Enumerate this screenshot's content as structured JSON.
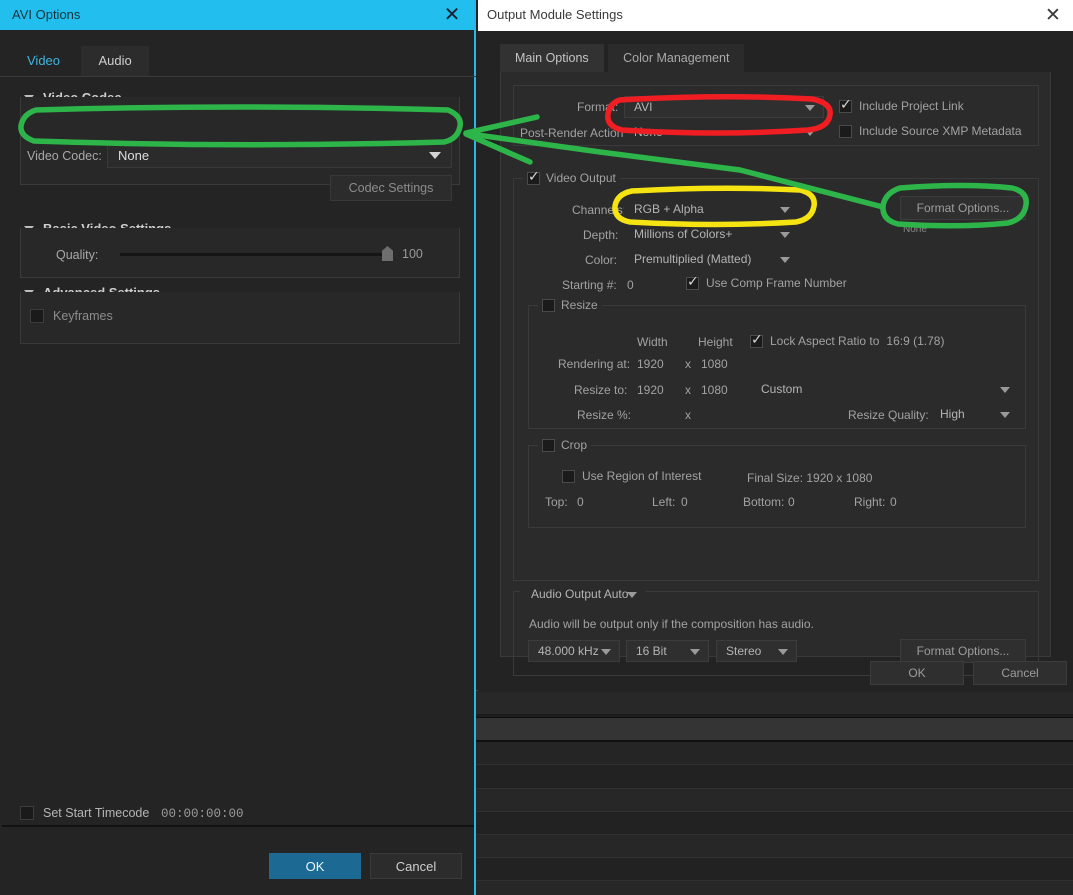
{
  "avi_dialog": {
    "title": "AVI Options",
    "close_icon": "close-icon",
    "tabs": [
      {
        "label": "Video",
        "active": true
      },
      {
        "label": "Audio",
        "active": false
      }
    ],
    "sections": {
      "video_codec": {
        "title": "Video Codec",
        "codec_label": "Video Codec:",
        "codec_value": "None",
        "codec_settings_button": "Codec Settings"
      },
      "basic_video_settings": {
        "title": "Basic Video Settings",
        "quality_label": "Quality:",
        "quality_value": "100"
      },
      "advanced_settings": {
        "title": "Advanced Settings",
        "keyframes_label": "Keyframes",
        "keyframes_checked": false
      }
    },
    "footer": {
      "set_start_timecode_label": "Set Start Timecode",
      "set_start_timecode_checked": false,
      "timecode_value": "00:00:00:00",
      "ok_label": "OK",
      "cancel_label": "Cancel"
    }
  },
  "output_module_dialog": {
    "title": "Output Module Settings",
    "close_icon": "close-icon",
    "tabs": [
      {
        "label": "Main Options",
        "active": true
      },
      {
        "label": "Color Management",
        "active": false
      }
    ],
    "format_group": {
      "format_label": "Format:",
      "format_value": "AVI",
      "post_render_label": "Post-Render Action:",
      "post_render_value": "None",
      "include_project_link_label": "Include Project Link",
      "include_project_link_checked": true,
      "include_xmp_label": "Include Source XMP Metadata",
      "include_xmp_checked": false
    },
    "video_output": {
      "legend": "Video Output",
      "legend_checked": true,
      "channels_label": "Channels:",
      "channels_value": "RGB + Alpha",
      "depth_label": "Depth:",
      "depth_value": "Millions of Colors+",
      "color_label": "Color:",
      "color_value": "Premultiplied (Matted)",
      "starting_label": "Starting #:",
      "starting_value": "0",
      "use_comp_frame_number_label": "Use Comp Frame Number",
      "use_comp_frame_number_checked": true,
      "format_options_button": "Format Options...",
      "format_options_status": "None",
      "resize": {
        "legend": "Resize",
        "legend_checked": false,
        "width_header": "Width",
        "height_header": "Height",
        "lock_aspect_label": "Lock Aspect Ratio to",
        "lock_aspect_ratio": "16:9 (1.78)",
        "lock_aspect_checked": true,
        "rendering_at_label": "Rendering at:",
        "rendering_width": "1920",
        "rendering_height": "1080",
        "resize_to_label": "Resize to:",
        "resize_width": "1920",
        "resize_height": "1080",
        "preset_value": "Custom",
        "resize_pct_label": "Resize %:",
        "x_symbol": "x",
        "resize_quality_label": "Resize Quality:",
        "resize_quality_value": "High"
      },
      "crop": {
        "legend": "Crop",
        "legend_checked": false,
        "use_region_label": "Use Region of Interest",
        "use_region_checked": false,
        "final_size_label": "Final Size: 1920 x 1080",
        "top_label": "Top:",
        "top_value": "0",
        "left_label": "Left:",
        "left_value": "0",
        "bottom_label": "Bottom:",
        "bottom_value": "0",
        "right_label": "Right:",
        "right_value": "0"
      }
    },
    "audio_output": {
      "legend": "Audio Output Auto",
      "note": "Audio will be output only if the composition has audio.",
      "sample_rate": "48.000 kHz",
      "bit_depth": "16 Bit",
      "channel_mode": "Stereo",
      "format_options_button": "Format Options..."
    },
    "footer": {
      "ok_label": "OK",
      "cancel_label": "Cancel"
    }
  },
  "annotations": {
    "green": "#2db54a",
    "red": "#f01e22",
    "yellow": "#f5e312",
    "arrow_description": "green-arrow-from-format-options-to-video-codec"
  }
}
